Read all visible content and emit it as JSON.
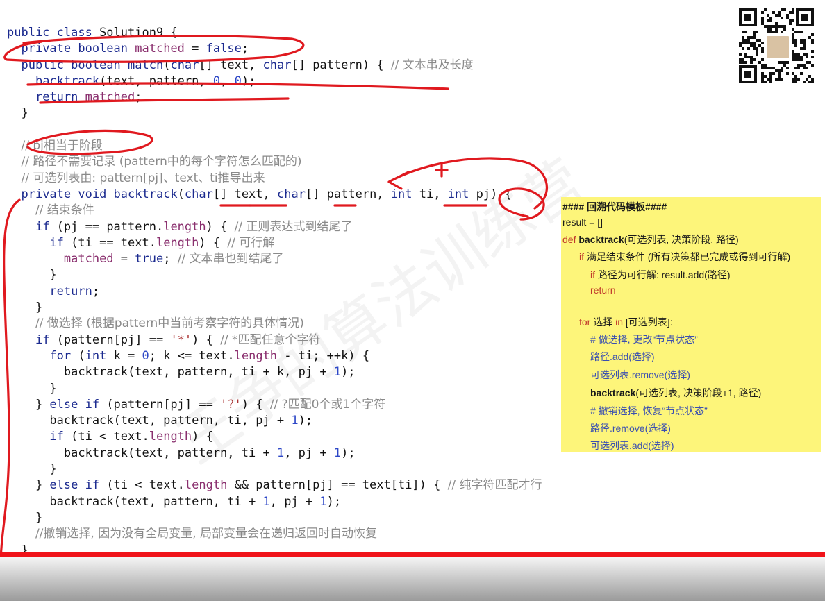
{
  "code_lines": [
    [
      [
        "kw",
        "public class "
      ],
      [
        "plain",
        "Solution9 {"
      ]
    ],
    [
      [
        "plain",
        "  "
      ],
      [
        "kw",
        "private boolean "
      ],
      [
        "fld",
        "matched "
      ],
      [
        "plain",
        "= "
      ],
      [
        "kw",
        "false"
      ],
      [
        "plain",
        ";"
      ]
    ],
    [
      [
        "plain",
        "  "
      ],
      [
        "kw",
        "public boolean "
      ],
      [
        "fn",
        "match"
      ],
      [
        "plain",
        "("
      ],
      [
        "kw",
        "char"
      ],
      [
        "plain",
        "[] text, "
      ],
      [
        "kw",
        "char"
      ],
      [
        "plain",
        "[] pattern) { "
      ],
      [
        "cmt",
        "// 文本串及长度"
      ]
    ],
    [
      [
        "plain",
        "    "
      ],
      [
        "fn",
        "backtrack"
      ],
      [
        "plain",
        "(text, pattern, "
      ],
      [
        "num",
        "0"
      ],
      [
        "plain",
        ", "
      ],
      [
        "num",
        "0"
      ],
      [
        "plain",
        ");"
      ]
    ],
    [
      [
        "plain",
        "    "
      ],
      [
        "kw",
        "return "
      ],
      [
        "fld",
        "matched"
      ],
      [
        "plain",
        ";"
      ]
    ],
    [
      [
        "plain",
        "  }"
      ]
    ],
    [
      [
        "plain",
        ""
      ]
    ],
    [
      [
        "plain",
        "  "
      ],
      [
        "cmt",
        "// pj相当于阶段"
      ]
    ],
    [
      [
        "plain",
        "  "
      ],
      [
        "cmt",
        "// 路径不需要记录 (pattern中的每个字符怎么匹配的)"
      ]
    ],
    [
      [
        "plain",
        "  "
      ],
      [
        "cmt",
        "// 可选列表由: pattern[pj]、text、ti推导出来"
      ]
    ],
    [
      [
        "plain",
        "  "
      ],
      [
        "kw",
        "private void "
      ],
      [
        "fn",
        "backtrack"
      ],
      [
        "plain",
        "("
      ],
      [
        "kw",
        "char"
      ],
      [
        "plain",
        "[] text, "
      ],
      [
        "kw",
        "char"
      ],
      [
        "plain",
        "[] pattern, "
      ],
      [
        "kw",
        "int "
      ],
      [
        "plain",
        "ti, "
      ],
      [
        "kw",
        "int "
      ],
      [
        "plain",
        "pj) {"
      ]
    ],
    [
      [
        "plain",
        "    "
      ],
      [
        "cmt",
        "// 结束条件"
      ]
    ],
    [
      [
        "plain",
        "    "
      ],
      [
        "kw",
        "if "
      ],
      [
        "plain",
        "(pj == pattern."
      ],
      [
        "fld",
        "length"
      ],
      [
        "plain",
        ") { "
      ],
      [
        "cmt",
        "// 正则表达式到结尾了"
      ]
    ],
    [
      [
        "plain",
        "      "
      ],
      [
        "kw",
        "if "
      ],
      [
        "plain",
        "(ti == text."
      ],
      [
        "fld",
        "length"
      ],
      [
        "plain",
        ") { "
      ],
      [
        "cmt",
        "// 可行解"
      ]
    ],
    [
      [
        "plain",
        "        "
      ],
      [
        "fld",
        "matched "
      ],
      [
        "plain",
        "= "
      ],
      [
        "kw",
        "true"
      ],
      [
        "plain",
        "; "
      ],
      [
        "cmt",
        "// 文本串也到结尾了"
      ]
    ],
    [
      [
        "plain",
        "      }"
      ]
    ],
    [
      [
        "plain",
        "      "
      ],
      [
        "kw",
        "return"
      ],
      [
        "plain",
        ";"
      ]
    ],
    [
      [
        "plain",
        "    }"
      ]
    ],
    [
      [
        "plain",
        "    "
      ],
      [
        "cmt",
        "// 做选择 (根据pattern中当前考察字符的具体情况)"
      ]
    ],
    [
      [
        "plain",
        "    "
      ],
      [
        "kw",
        "if "
      ],
      [
        "plain",
        "(pattern[pj] == "
      ],
      [
        "str",
        "'*'"
      ],
      [
        "plain",
        ") { "
      ],
      [
        "cmt",
        "// *匹配任意个字符"
      ]
    ],
    [
      [
        "plain",
        "      "
      ],
      [
        "kw",
        "for "
      ],
      [
        "plain",
        "("
      ],
      [
        "kw",
        "int "
      ],
      [
        "plain",
        "k = "
      ],
      [
        "num",
        "0"
      ],
      [
        "plain",
        "; k <= text."
      ],
      [
        "fld",
        "length "
      ],
      [
        "plain",
        "- ti; ++k) {"
      ]
    ],
    [
      [
        "plain",
        "        backtrack(text, pattern, ti + k, pj + "
      ],
      [
        "num",
        "1"
      ],
      [
        "plain",
        ");"
      ]
    ],
    [
      [
        "plain",
        "      }"
      ]
    ],
    [
      [
        "plain",
        "    } "
      ],
      [
        "kw",
        "else if "
      ],
      [
        "plain",
        "(pattern[pj] == "
      ],
      [
        "str",
        "'?'"
      ],
      [
        "plain",
        ") { "
      ],
      [
        "cmt",
        "// ?匹配0个或1个字符"
      ]
    ],
    [
      [
        "plain",
        "      backtrack(text, pattern, ti, pj + "
      ],
      [
        "num",
        "1"
      ],
      [
        "plain",
        ");"
      ]
    ],
    [
      [
        "plain",
        "      "
      ],
      [
        "kw",
        "if "
      ],
      [
        "plain",
        "(ti < text."
      ],
      [
        "fld",
        "length"
      ],
      [
        "plain",
        ") {"
      ]
    ],
    [
      [
        "plain",
        "        backtrack(text, pattern, ti + "
      ],
      [
        "num",
        "1"
      ],
      [
        "plain",
        ", pj + "
      ],
      [
        "num",
        "1"
      ],
      [
        "plain",
        ");"
      ]
    ],
    [
      [
        "plain",
        "      }"
      ]
    ],
    [
      [
        "plain",
        "    } "
      ],
      [
        "kw",
        "else if "
      ],
      [
        "plain",
        "(ti < text."
      ],
      [
        "fld",
        "length "
      ],
      [
        "plain",
        "&& pattern[pj] == text[ti]) { "
      ],
      [
        "cmt",
        "// 纯字符匹配才行"
      ]
    ],
    [
      [
        "plain",
        "      backtrack(text, pattern, ti + "
      ],
      [
        "num",
        "1"
      ],
      [
        "plain",
        ", pj + "
      ],
      [
        "num",
        "1"
      ],
      [
        "plain",
        ");"
      ]
    ],
    [
      [
        "plain",
        "    }"
      ]
    ],
    [
      [
        "plain",
        "    "
      ],
      [
        "cmt",
        "//撤销选择, 因为没有全局变量, 局部变量会在递归返回时自动恢复"
      ]
    ],
    [
      [
        "plain",
        "  }"
      ]
    ]
  ],
  "template_box": {
    "title": "#### 回溯代码模板####",
    "line_result": "result = []",
    "def_kw": "def ",
    "def_name": "backtrack",
    "def_args": "(可选列表, 决策阶段, 路径)",
    "if_kw": "if ",
    "if_text": "满足结束条件 (所有决策都已完成或得到可行解)",
    "if2_kw": "if ",
    "if2_text": "路径为可行解: result.add(路径)",
    "return_kw": "return",
    "for_kw": "for ",
    "for_mid": "选择 ",
    "in_kw": "in ",
    "for_rest": "[可选列表]:",
    "c1": "# 做选择, 更改“节点状态”",
    "c2": "路径.add(选择)",
    "c3": "可选列表.remove(选择)",
    "c4_name": "backtrack",
    "c4_args": "(可选列表, 决策阶段+1,  路径)",
    "c5": "# 撤销选择, 恢复“节点状态”",
    "c6": "路径.remove(选择)",
    "c7": "可选列表.add(选择)"
  },
  "watermark_text": "王争的算法训练营",
  "colors": {
    "keyword": "#1b2a8f",
    "comment": "#8a8a8a",
    "note_bg": "#fdf57a",
    "ink": "#e0191f"
  }
}
